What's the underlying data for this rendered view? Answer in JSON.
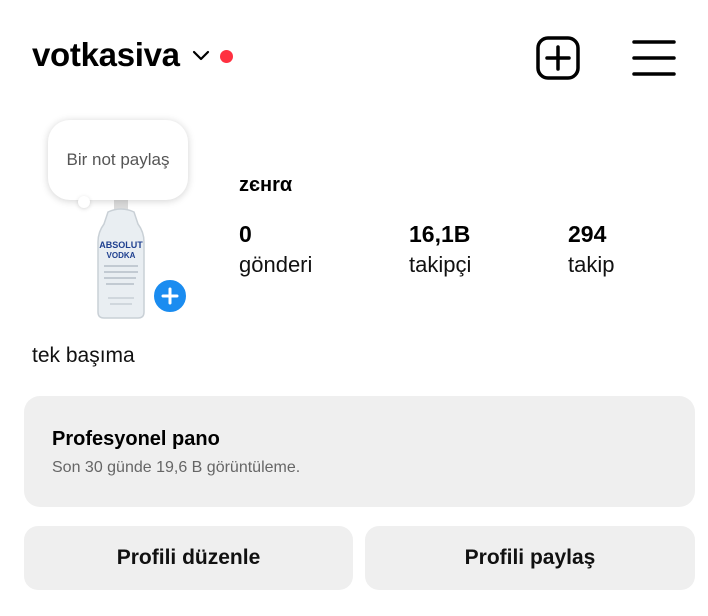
{
  "header": {
    "username": "votkasiva",
    "chevron_icon": "chevron-down-icon",
    "status_dot_color": "#ff3040",
    "create_icon": "plus-square-icon",
    "menu_icon": "hamburger-menu-icon"
  },
  "profile": {
    "note_prompt": "Bir not paylaş",
    "avatar_icon": "vodka-bottle-avatar",
    "avatar_brand": "ABSOLUT VODKA",
    "add_story_icon": "plus-icon",
    "display_name": "zєнrα",
    "stats": [
      {
        "value": "0",
        "label": "gönderi"
      },
      {
        "value": "16,1B",
        "label": "takipçi"
      },
      {
        "value": "294",
        "label": "takip"
      }
    ],
    "bio": "tek başıma"
  },
  "dashboard": {
    "title": "Profesyonel pano",
    "subtitle": "Son 30 günde 19,6 B görüntüleme."
  },
  "actions": {
    "edit_label": "Profili düzenle",
    "share_label": "Profili paylaş"
  },
  "colors": {
    "accent_blue": "#1a8cf0",
    "card_bg": "#efefef"
  }
}
